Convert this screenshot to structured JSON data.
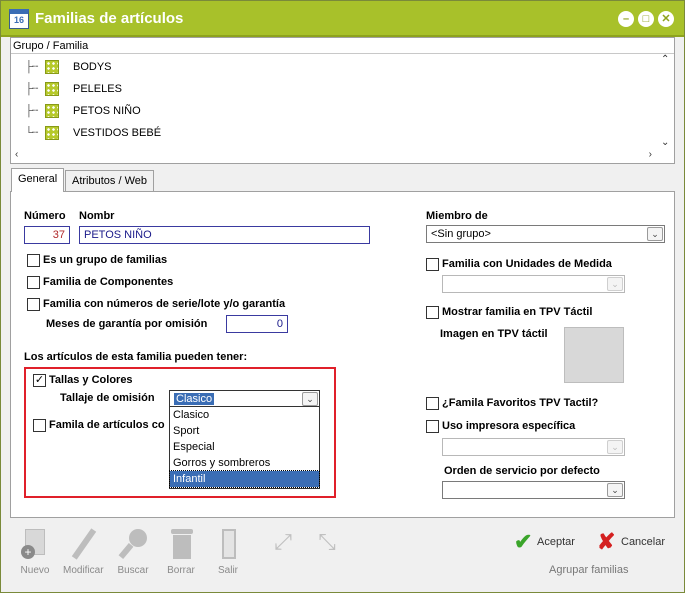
{
  "window": {
    "title": "Familias de artículos",
    "icon_text": "16"
  },
  "tree": {
    "header": "Grupo / Familia",
    "items": [
      "BODYS",
      "PELELES",
      "PETOS NIÑO",
      "VESTIDOS BEBÉ"
    ]
  },
  "tabs": [
    "General",
    "Atributos / Web"
  ],
  "general": {
    "numero_label": "Número",
    "numero_value": "37",
    "nombre_label": "Nombr",
    "nombre_value": "PETOS NIÑO",
    "es_grupo": "Es un grupo de familias",
    "familia_componentes": "Familia de Componentes",
    "familia_serie": "Familia con números de serie/lote y/o garantía",
    "meses_label": "Meses de garantía por omisión",
    "meses_value": "0",
    "articulos_heading": "Los artículos de esta familia pueden tener:",
    "tallas_colores": "Tallas y Colores",
    "tallas_checked": true,
    "tallaje_label": "Tallaje de omisión",
    "tallaje_value": "Clasico",
    "tallaje_options": [
      "Clasico",
      "Sport",
      "Especial",
      "Gorros y sombreros",
      "Infantil"
    ],
    "tallaje_highlighted": "Infantil",
    "familia_articulos_co": "Famila de artículos co",
    "miembro_label": "Miembro de",
    "miembro_value": "<Sin grupo>",
    "unidades_medida": "Familia con Unidades de Medida",
    "mostrar_tpv": "Mostrar familia en TPV Táctil",
    "imagen_tpv": "Imagen en TPV táctil",
    "favoritos_tpv": "¿Famila Favoritos TPV Tactil?",
    "uso_impresora": "Uso impresora específica",
    "orden_servicio": "Orden de servicio por defecto"
  },
  "toolbar": {
    "nuevo": "Nuevo",
    "modificar": "Modificar",
    "buscar": "Buscar",
    "borrar": "Borrar",
    "salir": "Salir"
  },
  "footer": {
    "aceptar": "Aceptar",
    "cancelar": "Cancelar",
    "agrupar": "Agrupar familias"
  },
  "colors": {
    "titlebar": "#a8c12a",
    "highlight_box": "#e0202a",
    "selection": "#3a6db5"
  }
}
